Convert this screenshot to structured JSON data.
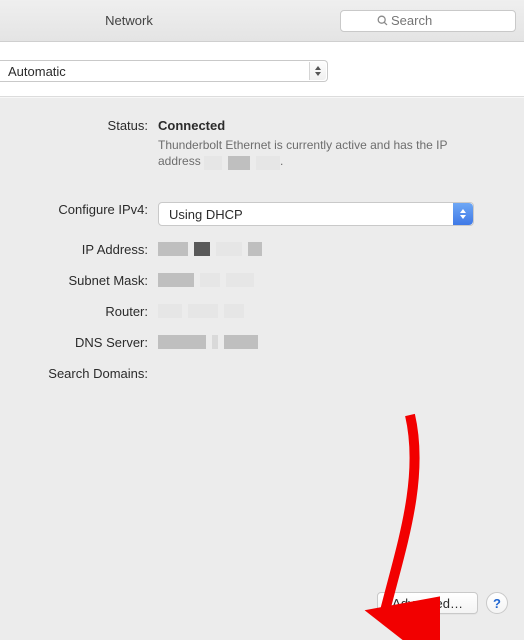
{
  "toolbar": {
    "title": "Network",
    "search_placeholder": "Search"
  },
  "location": {
    "selected": "Automatic"
  },
  "status": {
    "label": "Status:",
    "value": "Connected",
    "description_prefix": "Thunderbolt Ethernet is currently active and has the IP address ",
    "description_suffix": "."
  },
  "configure_ipv4": {
    "label": "Configure IPv4:",
    "selected": "Using DHCP"
  },
  "fields": {
    "ip_address": "IP Address:",
    "subnet_mask": "Subnet Mask:",
    "router": "Router:",
    "dns_server": "DNS Server:",
    "search_domains": "Search Domains:"
  },
  "buttons": {
    "advanced": "Advanced…",
    "help": "?"
  }
}
